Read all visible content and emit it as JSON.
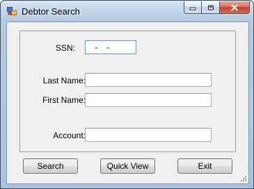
{
  "window": {
    "title": "Debtor Search",
    "icons": {
      "app": "app-icon",
      "minimize": "minimize-icon",
      "maximize": "maximize-icon",
      "close": "close-icon",
      "grip": "size-grip-icon"
    }
  },
  "form": {
    "ssn": {
      "label": "SSN:",
      "value": " -  -"
    },
    "last_name": {
      "label": "Last Name:",
      "value": ""
    },
    "first_name": {
      "label": "First Name:",
      "value": ""
    },
    "account": {
      "label": "Account:",
      "value": ""
    }
  },
  "buttons": {
    "search": "Search",
    "quick_view": "Quick View",
    "exit": "Exit"
  },
  "colors": {
    "title_bar": "#c4d7ec",
    "close_button": "#c1432b",
    "client_bg": "#f0f0f0",
    "focus_border": "#5b9bd5"
  }
}
